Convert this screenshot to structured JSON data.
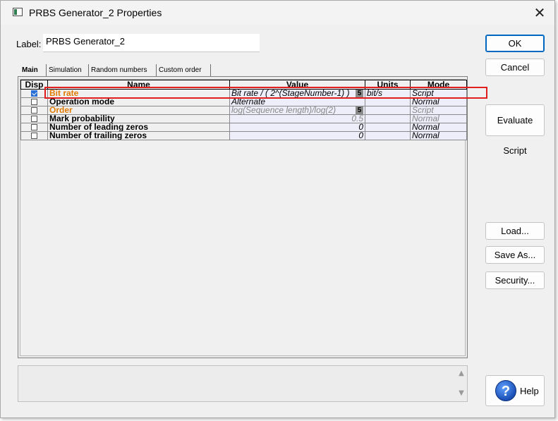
{
  "window": {
    "title": "PRBS Generator_2 Properties",
    "close_glyph": "✕"
  },
  "label_field": {
    "caption": "Label:",
    "value": "PRBS Generator_2"
  },
  "tabs": [
    {
      "label": "Main"
    },
    {
      "label": "Simulation"
    },
    {
      "label": "Random numbers"
    },
    {
      "label": "Custom order"
    }
  ],
  "grid": {
    "headers": {
      "disp": "Disp",
      "name": "Name",
      "value": "Value",
      "units": "Units",
      "mode": "Mode"
    },
    "rows": [
      {
        "disp": true,
        "name": "Bit rate",
        "value": "Bit rate / ( 2^(StageNumber-1) )",
        "badge": "5",
        "units": "bit/s",
        "mode": "Script"
      },
      {
        "disp": false,
        "name": "Operation mode",
        "value": "Alternate",
        "units": "",
        "mode": "Normal"
      },
      {
        "disp": false,
        "name": "Order",
        "value": "log(Sequence length)/log(2)",
        "badge": "5",
        "units": "",
        "mode": "Script"
      },
      {
        "disp": false,
        "name": "Mark probability",
        "value": "0.5",
        "units": "",
        "mode": "Normal"
      },
      {
        "disp": false,
        "name": "Number of leading zeros",
        "value": "0",
        "units": "",
        "mode": "Normal"
      },
      {
        "disp": false,
        "name": "Number of trailing zeros",
        "value": "0",
        "units": "",
        "mode": "Normal"
      }
    ]
  },
  "buttons": {
    "ok": "OK",
    "cancel": "Cancel",
    "evaluate": "Evaluate Script",
    "load": "Load...",
    "save_as": "Save As...",
    "security": "Security...",
    "help": "Help",
    "help_glyph": "?"
  },
  "icons": [
    "app-icon",
    "close-icon",
    "scroll-up-icon",
    "scroll-down-icon",
    "help-icon"
  ],
  "colors": {
    "highlight": "#e01e1e",
    "script_name": "#e07a00",
    "ok_border": "#0067c0"
  }
}
